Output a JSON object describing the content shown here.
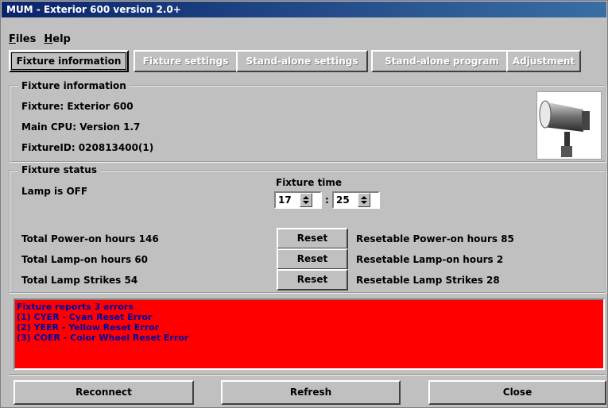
{
  "window": {
    "title": "MUM - Exterior 600 version 2.0+"
  },
  "menu": {
    "files": "Files",
    "files_key": "F",
    "files_rest": "iles",
    "help_key": "H",
    "help_rest": "elp"
  },
  "tabs": [
    {
      "label": "Fixture information",
      "active": true
    },
    {
      "label": "Fixture settings",
      "active": false
    },
    {
      "label": "Stand-alone settings",
      "active": false
    },
    {
      "label": "Stand-alone program",
      "active": false
    },
    {
      "label": "Adjustment",
      "active": false
    }
  ],
  "fixture_info": {
    "legend": "Fixture information",
    "fixture": "Fixture: Exterior 600",
    "cpu": "Main CPU: Version 1.7",
    "fixture_id": "FixtureID: 020813400(1)"
  },
  "fixture_status": {
    "legend": "Fixture status",
    "lamp": "Lamp is OFF",
    "time_label": "Fixture time",
    "hours": "17",
    "separator": ":",
    "minutes": "25",
    "rows": [
      {
        "total": "Total Power-on hours 146",
        "reset": "Reset",
        "resetable": "Resetable Power-on hours 85"
      },
      {
        "total": "Total Lamp-on hours 60",
        "reset": "Reset",
        "resetable": "Resetable Lamp-on hours 2"
      },
      {
        "total": "Total Lamp Strikes 54",
        "reset": "Reset",
        "resetable": "Resetable Lamp Strikes 28"
      }
    ]
  },
  "errors": {
    "heading": "Fixture reports 3 errors",
    "items": [
      "(1) CYER - Cyan Reset Error",
      "(2) YEER - Yellow Reset Error",
      "(3) COER - Color Wheel Reset Error"
    ],
    "bg_color": "#ff0000",
    "text_color": "#0000a0"
  },
  "footer": {
    "reconnect": "Reconnect",
    "refresh": "Refresh",
    "close": "Close"
  },
  "icons": {
    "fixture_image": "spotlight-fixture-icon",
    "spin_up": "spin-up-icon",
    "spin_down": "spin-down-icon"
  }
}
